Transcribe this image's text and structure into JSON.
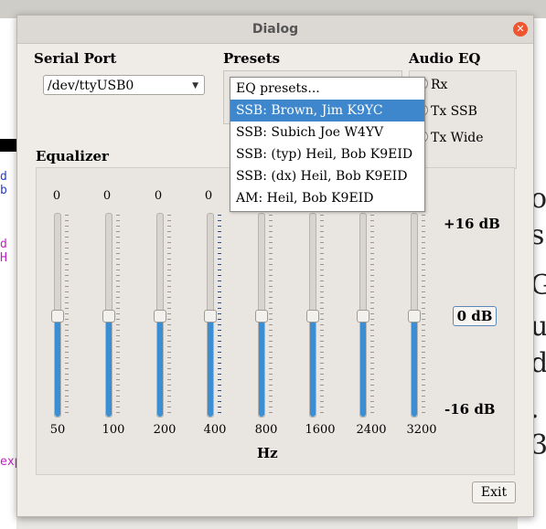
{
  "dialog": {
    "title": "Dialog"
  },
  "serial": {
    "label": "Serial Port",
    "value": "/dev/ttyUSB0"
  },
  "presets": {
    "label": "Presets",
    "items": [
      {
        "label": "EQ presets..."
      },
      {
        "label": "SSB: Brown, Jim K9YC",
        "selected": true
      },
      {
        "label": "SSB: Subich Joe W4YV"
      },
      {
        "label": "SSB: (typ) Heil, Bob K9EID"
      },
      {
        "label": "SSB: (dx) Heil, Bob K9EID"
      },
      {
        "label": "AM: Heil, Bob K9EID"
      }
    ]
  },
  "audio_eq": {
    "label": "Audio EQ",
    "options": [
      {
        "label": "Rx"
      },
      {
        "label": "Tx SSB"
      },
      {
        "label": "Tx Wide"
      }
    ]
  },
  "equalizer": {
    "label": "Equalizer",
    "bands": [
      {
        "freq": "50",
        "value": "0"
      },
      {
        "freq": "100",
        "value": "0"
      },
      {
        "freq": "200",
        "value": "0"
      },
      {
        "freq": "400",
        "value": "0"
      },
      {
        "freq": "800",
        "value": ""
      },
      {
        "freq": "1600",
        "value": ""
      },
      {
        "freq": "2400",
        "value": ""
      },
      {
        "freq": "3200",
        "value": ""
      }
    ],
    "max_label": "+16 dB",
    "mid_label": "0 dB",
    "min_label": "-16 dB",
    "unit_label": "Hz"
  },
  "exit_label": "Exit",
  "colors": {
    "accent": "#3e87cc",
    "fill": "#3a8fd4",
    "close": "#ee5530"
  }
}
